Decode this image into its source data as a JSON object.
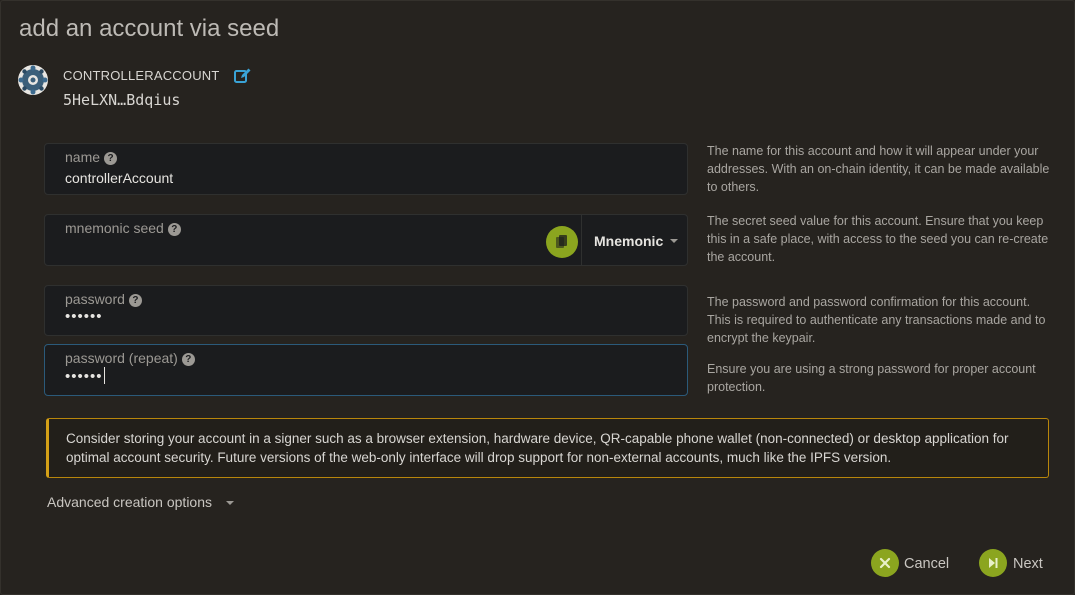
{
  "modal": {
    "title": "add an account via seed"
  },
  "account": {
    "name": "CONTROLLERACCOUNT",
    "address": "5HeLXN…Bdqius",
    "icon": "identicon",
    "edit_icon": "edit-icon"
  },
  "fields": {
    "name": {
      "label": "name",
      "help": "?",
      "value": "controllerAccount",
      "description": "The name for this account and how it will appear under your addresses. With an on-chain identity, it can be made available to others."
    },
    "seed": {
      "label": "mnemonic seed",
      "help": "?",
      "value": "",
      "type_selected": "Mnemonic",
      "copy_icon": "copy-icon",
      "description": "The secret seed value for this account. Ensure that you keep this in a safe place, with access to the seed you can re-create the account."
    },
    "password": {
      "label": "password",
      "help": "?",
      "value": "••••••",
      "description": "The password and password confirmation for this account. This is required to authenticate any transactions made and to encrypt the keypair."
    },
    "password_repeat": {
      "label": "password (repeat)",
      "help": "?",
      "value": "••••••",
      "description": "Ensure you are using a strong password for proper account protection."
    }
  },
  "warning": {
    "text": "Consider storing your account in a signer such as a browser extension, hardware device, QR-capable phone wallet (non-connected) or desktop application for optimal account security. Future versions of the web-only interface will drop support for non-external accounts, much like the IPFS version."
  },
  "advanced": {
    "label": "Advanced creation options"
  },
  "actions": {
    "cancel_label": "Cancel",
    "next_label": "Next"
  },
  "colors": {
    "accent": "#8ba51f",
    "background": "#26231f",
    "warning_border": "#d4a017",
    "focus_border": "#2b5a7a"
  }
}
